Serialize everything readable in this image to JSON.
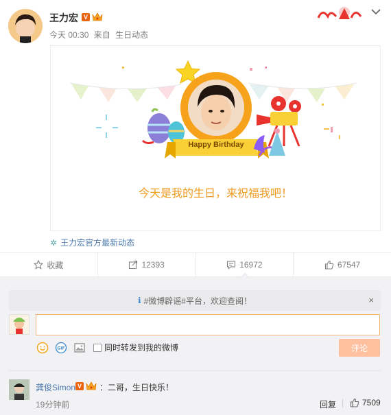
{
  "post": {
    "author": "王力宏",
    "verified_mark": "V",
    "time": "今天 00:30",
    "source_prefix": "来自",
    "source": "生日动态",
    "card": {
      "ribbon": "Happy Birthday",
      "message": "今天是我的生日，来祝福我吧！"
    },
    "source_link": "王力宏官方最新动态"
  },
  "actions": {
    "favorite": "收藏",
    "repost_count": "12393",
    "comment_count": "16972",
    "like_count": "67547"
  },
  "comment_box": {
    "notice": "#微博辟谣#平台，欢迎查阅！",
    "notice_close": "×",
    "input_value": "",
    "repost_label": "同时转发到我的微博",
    "submit_label": "评论"
  },
  "comments": [
    {
      "author": "龚俊Simon",
      "verified_mark": "V",
      "text": "：二哥，生日快乐！",
      "time": "19分钟前",
      "reply_label": "回复",
      "likes": "7509"
    }
  ],
  "colors": {
    "accent_orange": "#e8640e",
    "link_blue": "#507daf",
    "card_text": "#f09a1c",
    "submit_disabled": "#ffc09f"
  }
}
